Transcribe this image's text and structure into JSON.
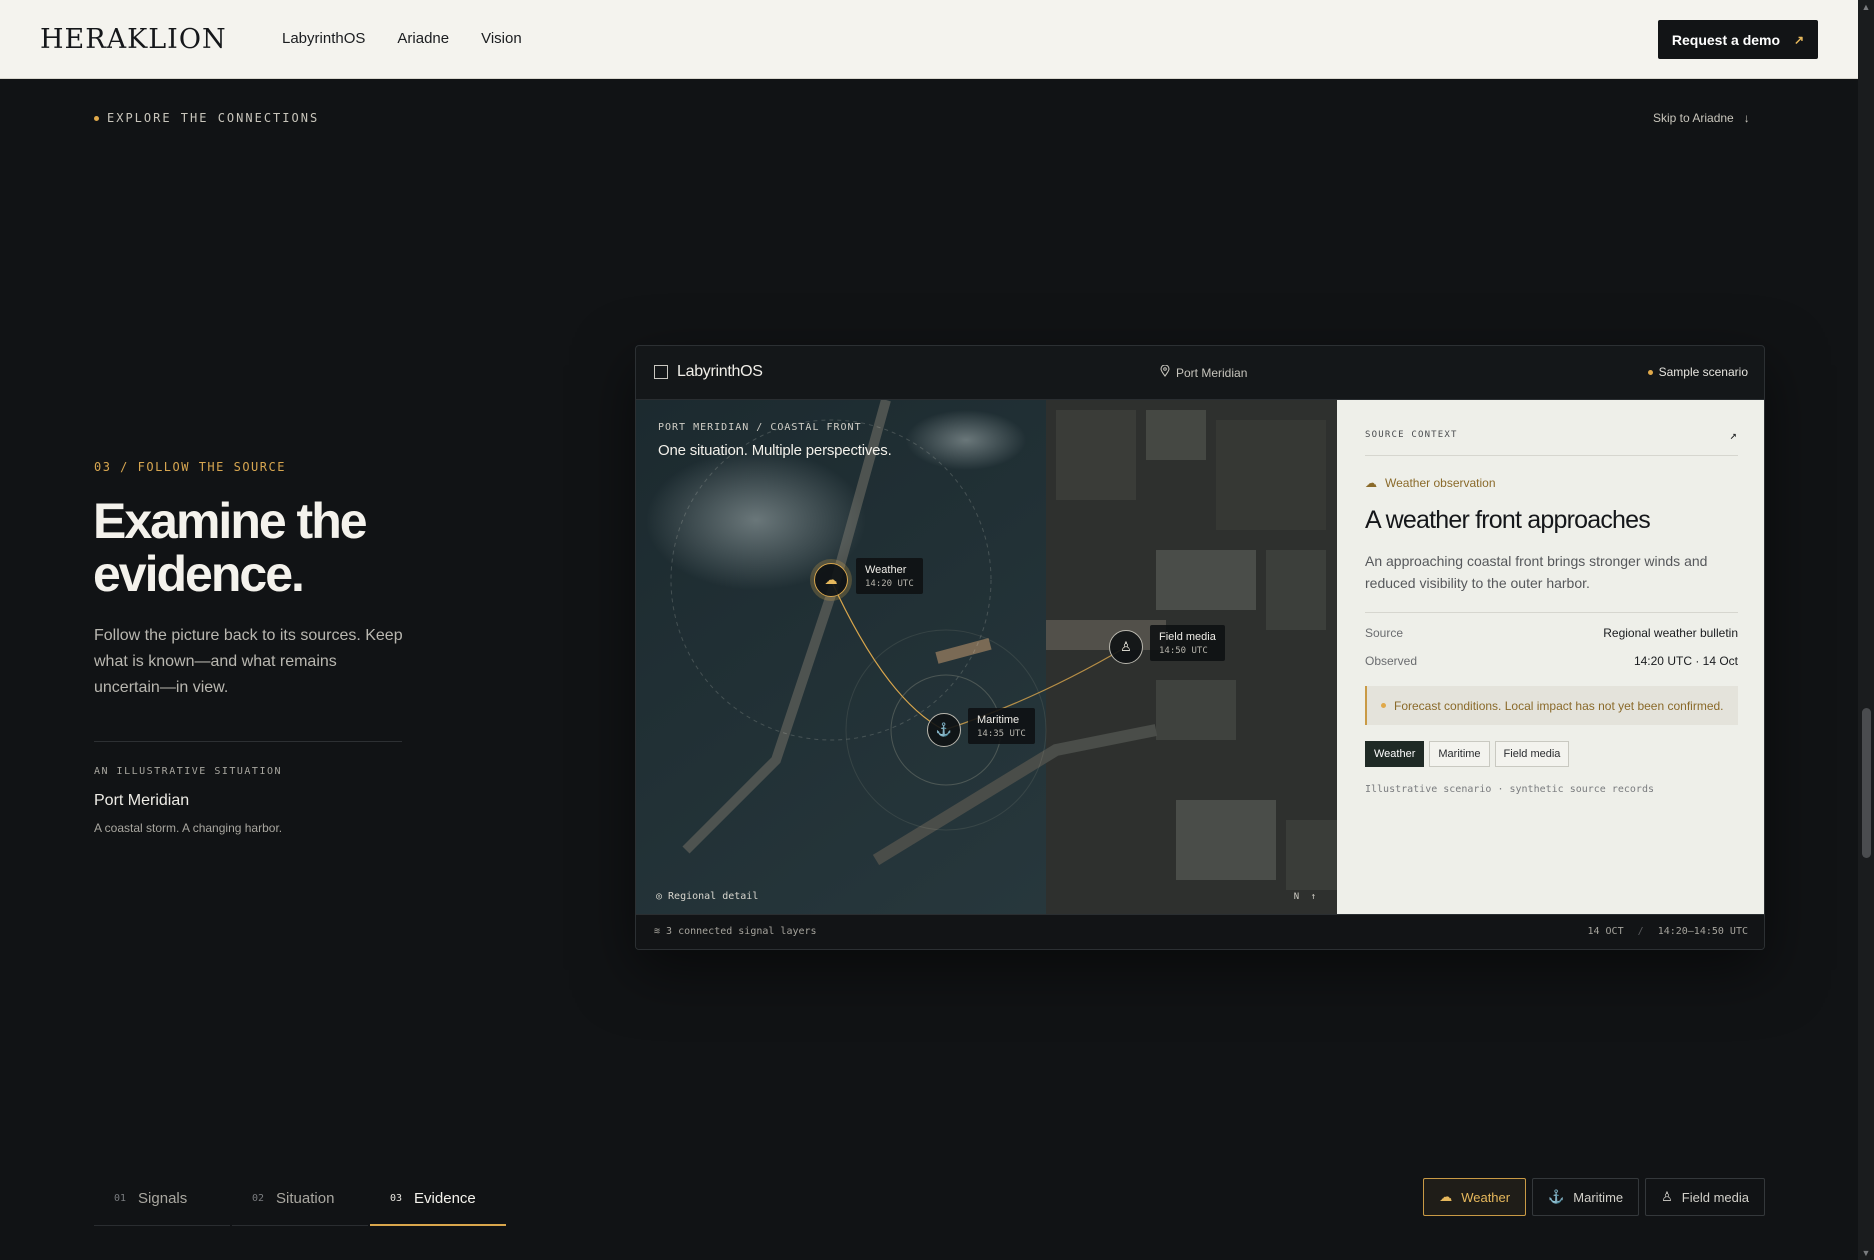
{
  "nav": {
    "logo": "HERAKLION",
    "links": [
      "LabyrinthOS",
      "Ariadne",
      "Vision"
    ],
    "cta": "Request a demo"
  },
  "section": {
    "explore": "EXPLORE THE CONNECTIONS",
    "skip": "Skip to Ariadne",
    "eyebrow": "03 / FOLLOW THE SOURCE",
    "headline": "Examine the evidence.",
    "lead": "Follow the picture back to its sources. Keep what is known—and what remains uncertain—in view.",
    "illustrative_label": "AN ILLUSTRATIVE SITUATION",
    "illustrative_title": "Port Meridian",
    "illustrative_sub": "A coastal storm. A changing harbor."
  },
  "app": {
    "name": "LabyrinthOS",
    "location": "Port Meridian",
    "sample": "Sample scenario",
    "map_crumb": "PORT MERIDIAN / COASTAL FRONT",
    "map_title": "One situation. Multiple perspectives.",
    "nodes": [
      {
        "label": "Weather",
        "time": "14:20 UTC",
        "icon": "cloud-icon"
      },
      {
        "label": "Maritime",
        "time": "14:35 UTC",
        "icon": "ship-icon"
      },
      {
        "label": "Field media",
        "time": "14:50 UTC",
        "icon": "person-icon"
      }
    ],
    "regional": "Regional detail",
    "compass": "N ↑",
    "layers": "3 connected signal layers",
    "date": "14 OCT",
    "range": "14:20–14:50 UTC"
  },
  "panel": {
    "head": "SOURCE CONTEXT",
    "observation": "Weather observation",
    "title": "A weather front approaches",
    "desc": "An approaching coastal front brings stronger winds and reduced visibility to the outer harbor.",
    "source_key": "Source",
    "source_val": "Regional weather bulletin",
    "observed_key": "Observed",
    "observed_val": "14:20 UTC · 14 Oct",
    "warning": "Forecast conditions. Local impact has not yet been confirmed.",
    "chips": [
      "Weather",
      "Maritime",
      "Field media"
    ],
    "footer": "Illustrative scenario · synthetic source records"
  },
  "tabs": [
    {
      "num": "01",
      "label": "Signals"
    },
    {
      "num": "02",
      "label": "Situation"
    },
    {
      "num": "03",
      "label": "Evidence"
    }
  ],
  "filters": [
    "Weather",
    "Maritime",
    "Field media"
  ],
  "colors": {
    "accent": "#d9a64c",
    "bg": "#111315",
    "panel": "#eeefe9"
  }
}
